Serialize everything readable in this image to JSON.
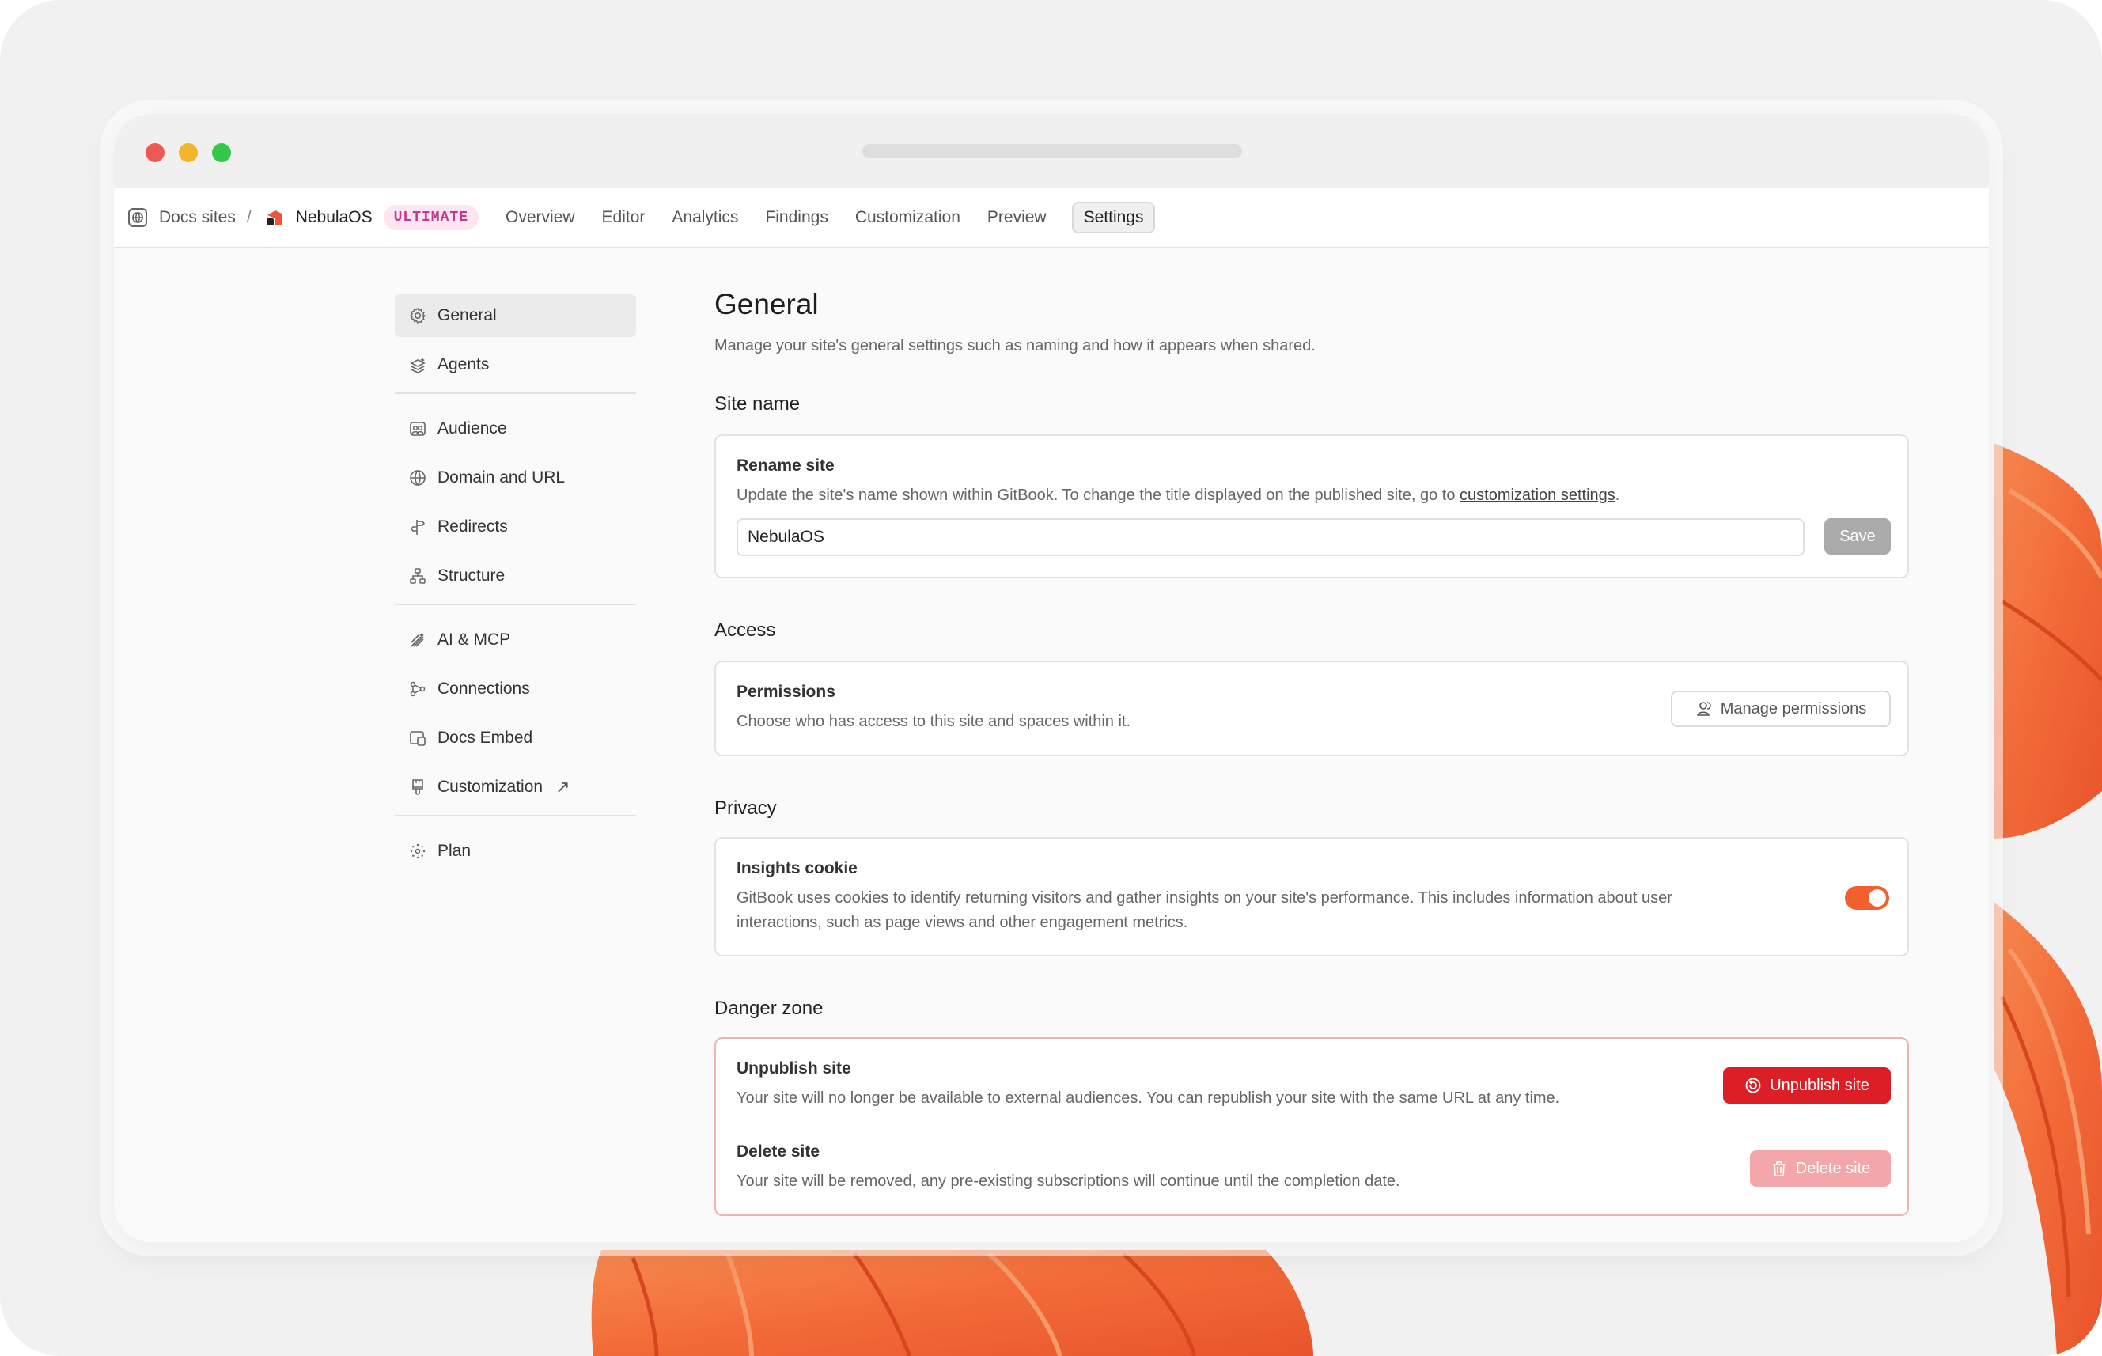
{
  "breadcrumb": {
    "root": "Docs sites",
    "separator": "/",
    "site": "NebulaOS",
    "plan_badge": "ULTIMATE"
  },
  "nav": {
    "tabs": [
      "Overview",
      "Editor",
      "Analytics",
      "Findings",
      "Customization",
      "Preview",
      "Settings"
    ],
    "active": "Settings"
  },
  "sidebar": {
    "items": [
      {
        "label": "General",
        "icon": "gear-icon",
        "active": true
      },
      {
        "label": "Agents",
        "icon": "agents-icon"
      },
      {
        "label": "Audience",
        "icon": "audience-icon"
      },
      {
        "label": "Domain and URL",
        "icon": "globe-icon"
      },
      {
        "label": "Redirects",
        "icon": "signpost-icon"
      },
      {
        "label": "Structure",
        "icon": "sitemap-icon"
      },
      {
        "label": "AI & MCP",
        "icon": "ai-icon"
      },
      {
        "label": "Connections",
        "icon": "connections-icon"
      },
      {
        "label": "Docs Embed",
        "icon": "embed-icon"
      },
      {
        "label": "Customization",
        "icon": "brush-icon",
        "external": "↗"
      },
      {
        "label": "Plan",
        "icon": "plan-icon"
      }
    ]
  },
  "page": {
    "title": "General",
    "subtitle": "Manage your site's general settings such as naming and how it appears when shared."
  },
  "site_name": {
    "heading": "Site name",
    "card_title": "Rename site",
    "desc_prefix": "Update the site's name shown within GitBook. To change the title displayed on the published site, go to ",
    "desc_link": "customization settings",
    "desc_suffix": ".",
    "input_value": "NebulaOS",
    "save_label": "Save"
  },
  "access": {
    "heading": "Access",
    "card_title": "Permissions",
    "desc": "Choose who has access to this site and spaces within it.",
    "button": "Manage permissions"
  },
  "privacy": {
    "heading": "Privacy",
    "card_title": "Insights cookie",
    "desc_line1": "GitBook uses cookies to identify returning visitors and gather insights on your site's performance. This includes information about user",
    "desc_line2": "interactions, such as page views and other engagement metrics.",
    "toggle_on": true
  },
  "danger": {
    "heading": "Danger zone",
    "unpublish_title": "Unpublish site",
    "unpublish_desc": "Your site will no longer be available to external audiences. You can republish your site with the same URL at any time.",
    "unpublish_button": "Unpublish site",
    "delete_title": "Delete site",
    "delete_desc": "Your site will be removed, any pre-existing subscriptions will continue until the completion date.",
    "delete_button": "Delete site"
  },
  "colors": {
    "accent": "#f2602e",
    "danger": "#dc1f26",
    "danger_disabled": "#f4a7aa",
    "badge_text": "#c2398d",
    "badge_bg": "#fde6f1"
  }
}
